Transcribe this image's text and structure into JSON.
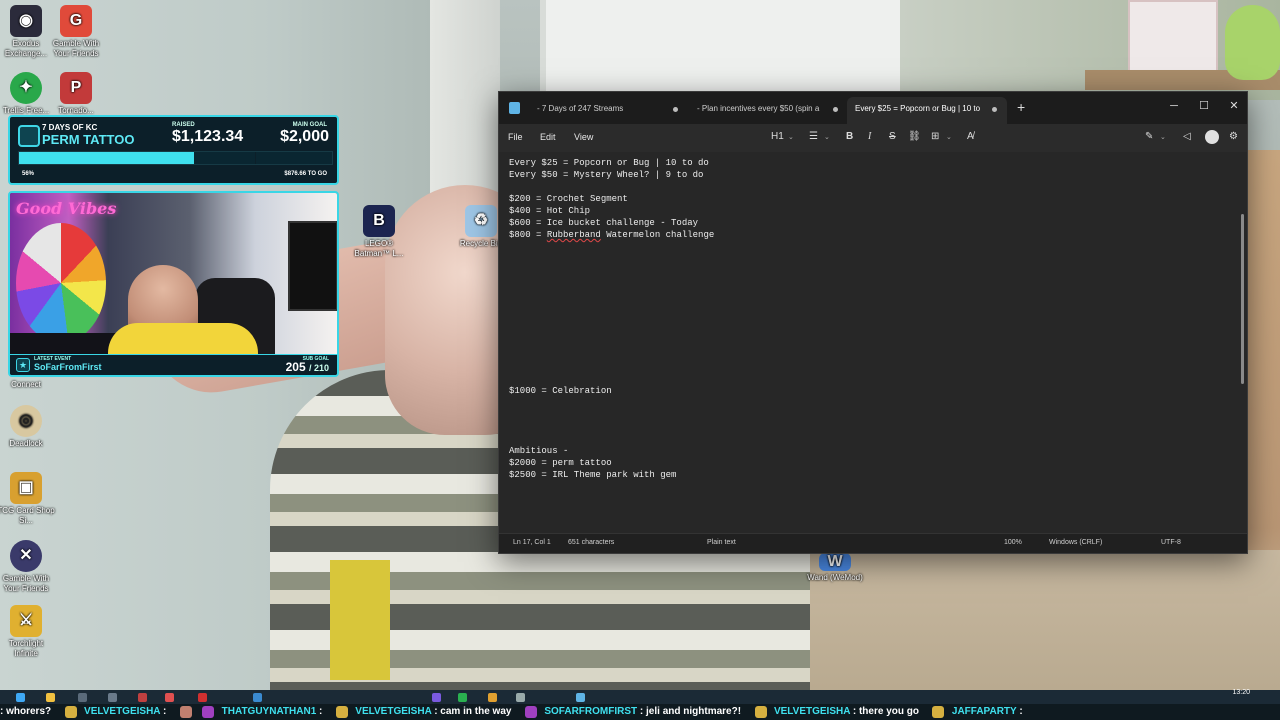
{
  "desktop": {
    "icons": [
      {
        "id": "exodus",
        "label": "Exodus Exchange...",
        "color": "#2b2b3b",
        "glyph": "◉"
      },
      {
        "id": "gamble-top",
        "label": "Gamble With Your Friends",
        "color": "#e04a3a",
        "glyph": "G"
      },
      {
        "id": "trellis",
        "label": "Trellis Free...",
        "color": "#29a84a",
        "glyph": "✦"
      },
      {
        "id": "tornado",
        "label": "Tornado...",
        "color": "#c23a3a",
        "glyph": "P"
      },
      {
        "id": "lego-batman",
        "label": "LEGO® Batman™ L...",
        "color": "#1c2550",
        "glyph": "B"
      },
      {
        "id": "recycle-bin",
        "label": "Recycle Bin",
        "color": "#9ec6e6",
        "glyph": "♻"
      },
      {
        "id": "steam-connect",
        "label": "Connect",
        "color": "#1b2838",
        "glyph": "⊙"
      },
      {
        "id": "deadlock",
        "label": "Deadlock",
        "color": "#d8c8a0",
        "glyph": "◎"
      },
      {
        "id": "tcg-card-shop",
        "label": "TCG Card Shop Si...",
        "color": "#d8a030",
        "glyph": "▣"
      },
      {
        "id": "gamble-with-friends",
        "label": "Gamble With Your Friends",
        "color": "#3a3a6a",
        "glyph": "✕"
      },
      {
        "id": "torchlight",
        "label": "Torchlight Infinite",
        "color": "#e0b030",
        "glyph": "⚔"
      },
      {
        "id": "wand",
        "label": "Wand (WeMod)",
        "color": "#4a8ae6",
        "glyph": "W"
      }
    ]
  },
  "overlay": {
    "goal": {
      "title": "7 DAYS OF KC",
      "name": "PERM TATTOO",
      "raised_label": "RAISED",
      "raised_value": "$1,123.34",
      "main_goal_label": "MAIN GOAL",
      "main_goal_value": "$2,000",
      "progress_fraction": 0.56,
      "percent_label": "56%",
      "to_go_label": "$876.66 TO GO"
    },
    "cam": {
      "neon_text": "Good Vibes",
      "latest_label": "LATEST EVENT",
      "latest_name": "SoFarFromFirst",
      "sub_label": "SUB GOAL",
      "sub_current": "205",
      "sub_total": "/ 210"
    },
    "colors": {
      "accent": "#39d6e6",
      "panel": "#0c1f29"
    }
  },
  "notepad": {
    "tabs": [
      {
        "label": "- 7 Days of 247 Streams",
        "active": false
      },
      {
        "label": "- Plan incentives every $50 (spin a",
        "active": false
      },
      {
        "label": "Every $25 = Popcorn or Bug | 10 to",
        "active": true
      }
    ],
    "menu": {
      "file": "File",
      "edit": "Edit",
      "view": "View"
    },
    "toolbar": {
      "heading": "H1"
    },
    "lines": [
      "Every $25 = Popcorn or Bug | 10 to do",
      "Every $50 = Mystery Wheel? | 9 to do",
      "$200 = Crochet Segment",
      "$400 = Hot Chip",
      "$600 = Ice bucket challenge - Today",
      "$800 = ",
      "Rubberband",
      " Watermelon challenge",
      "$1000 = Celebration",
      "Ambitious -",
      "$2000 = perm tattoo",
      "$2500 = IRL Theme park with gem"
    ],
    "status": {
      "position": "Ln 17, Col 1",
      "characters": "651 characters",
      "format": "Plain text",
      "zoom": "100%",
      "line_ending": "Windows (CRLF)",
      "encoding": "UTF-8"
    }
  },
  "taskbar": {
    "time": "13:20"
  },
  "chat_ticker": [
    {
      "user": "",
      "message": ": whorers?"
    },
    {
      "user": "VELVETGEISHA",
      "message": ":"
    },
    {
      "user": "THATGUYNATHAN1",
      "message": ":"
    },
    {
      "user": "VELVETGEISHA",
      "message": ": cam in the way"
    },
    {
      "user": "SOFARFROMFIRST",
      "message": ": jeli and nightmare?!"
    },
    {
      "user": "VELVETGEISHA",
      "message": ": there you go"
    },
    {
      "user": "JAFFAPARTY",
      "message": ":"
    }
  ]
}
